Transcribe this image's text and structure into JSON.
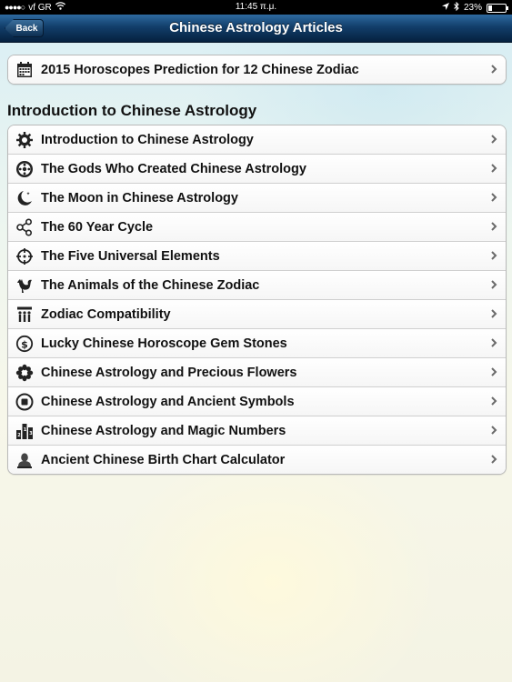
{
  "status": {
    "carrier": "vf GR",
    "time": "11:45 π.μ.",
    "battery": "23%",
    "battery_level": 0.23
  },
  "nav": {
    "title": "Chinese Astrology Articles",
    "back": "Back"
  },
  "featured": {
    "label": "2015 Horoscopes Prediction for 12 Chinese Zodiac",
    "icon": "calendar-icon"
  },
  "section": {
    "header": "Introduction to Chinese Astrology",
    "items": [
      {
        "label": "Introduction to Chinese Astrology",
        "icon": "gear-icon"
      },
      {
        "label": "The Gods Who Created Chinese Astrology",
        "icon": "emblem-icon"
      },
      {
        "label": "The Moon in Chinese Astrology",
        "icon": "moon-icon"
      },
      {
        "label": "The 60 Year Cycle",
        "icon": "share-nodes-icon"
      },
      {
        "label": "The Five Universal Elements",
        "icon": "crosshair-icon"
      },
      {
        "label": "The Animals of the Chinese Zodiac",
        "icon": "rooster-icon"
      },
      {
        "label": "Zodiac Compatibility",
        "icon": "people-icon"
      },
      {
        "label": "Lucky Chinese Horoscope Gem Stones",
        "icon": "coin-icon"
      },
      {
        "label": "Chinese Astrology and Precious Flowers",
        "icon": "flower-icon"
      },
      {
        "label": "Chinese Astrology and Ancient Symbols",
        "icon": "symbol-icon"
      },
      {
        "label": "Chinese Astrology and Magic Numbers",
        "icon": "numbers-icon"
      },
      {
        "label": "Ancient Chinese Birth Chart Calculator",
        "icon": "person-icon"
      }
    ]
  }
}
